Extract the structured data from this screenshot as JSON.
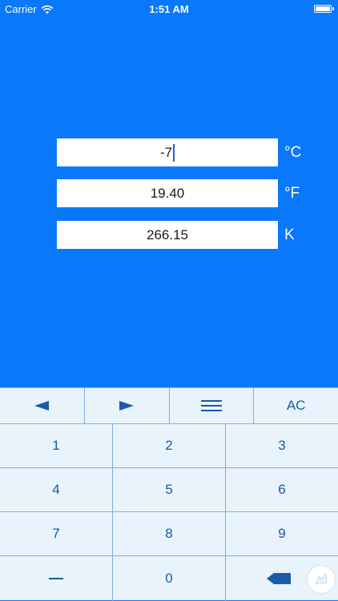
{
  "status_bar": {
    "carrier": "Carrier",
    "time": "1:51 AM"
  },
  "converter": {
    "rows": [
      {
        "value": "-7",
        "unit": "°C",
        "focused": true
      },
      {
        "value": "19.40",
        "unit": "°F",
        "focused": false
      },
      {
        "value": "266.15",
        "unit": "K",
        "focused": false
      }
    ]
  },
  "keyboard": {
    "top_row": {
      "left_icon": "left-arrow-icon",
      "right_icon": "right-arrow-icon",
      "menu_icon": "menu-icon",
      "clear_label": "AC"
    },
    "digits": [
      "1",
      "2",
      "3",
      "4",
      "5",
      "6",
      "7",
      "8",
      "9"
    ],
    "zero": "0",
    "minus_icon": "minus-icon",
    "backspace_icon": "backspace-icon",
    "hide_icon": "keyboard-hide-icon"
  },
  "colors": {
    "background": "#0a78fb",
    "key_text": "#1b5aa8",
    "keyboard_bg": "#e8f3fc",
    "divider": "#7faee4"
  }
}
